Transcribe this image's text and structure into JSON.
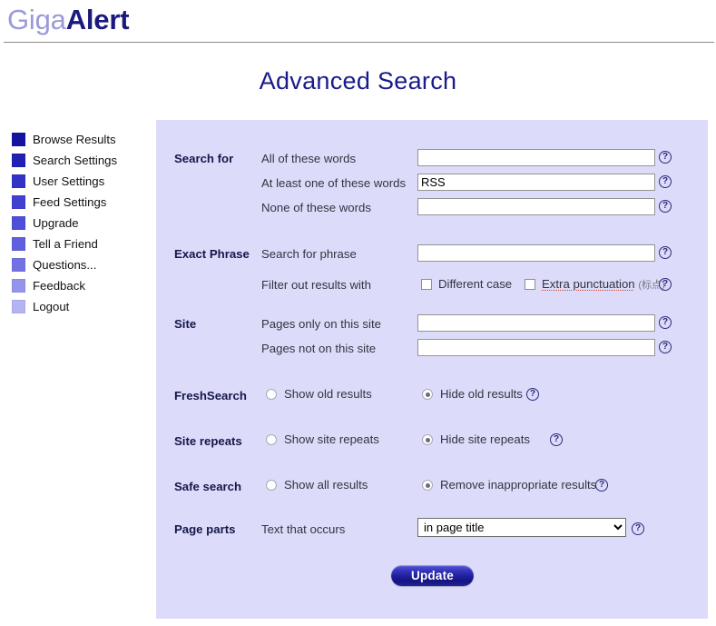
{
  "header": {
    "logo_part1": "Giga",
    "logo_part2": "Alert"
  },
  "page_title": "Advanced Search",
  "sidebar": {
    "items": [
      {
        "label": "Browse Results",
        "color": "#1414a0"
      },
      {
        "label": "Search Settings",
        "color": "#2020b4"
      },
      {
        "label": "User Settings",
        "color": "#3232c8"
      },
      {
        "label": "Feed Settings",
        "color": "#4040d2"
      },
      {
        "label": "Upgrade",
        "color": "#4e4ed8"
      },
      {
        "label": "Tell a Friend",
        "color": "#6060de"
      },
      {
        "label": "Questions...",
        "color": "#7272e4"
      },
      {
        "label": "Feedback",
        "color": "#9494ec"
      },
      {
        "label": "Logout",
        "color": "#b4b4f4"
      }
    ]
  },
  "form": {
    "search_for": {
      "section": "Search for",
      "all_words_label": "All of these words",
      "all_words_value": "",
      "any_words_label": "At least one of these words",
      "any_words_value": "RSS",
      "none_words_label": "None of these words",
      "none_words_value": ""
    },
    "exact_phrase": {
      "section": "Exact Phrase",
      "phrase_label": "Search for phrase",
      "phrase_value": "",
      "filter_label": "Filter out results with",
      "different_case_label": "Different case",
      "different_case_checked": false,
      "extra_punctuation_label": "Extra punctuation",
      "extra_punctuation_cjk": "(标点)",
      "extra_punctuation_checked": false
    },
    "site": {
      "section": "Site",
      "only_label": "Pages only on this site",
      "only_value": "",
      "not_label": "Pages not on this site",
      "not_value": ""
    },
    "freshsearch": {
      "section": "FreshSearch",
      "option_show": "Show old results",
      "option_hide": "Hide old results",
      "selected": "hide"
    },
    "site_repeats": {
      "section": "Site repeats",
      "option_show": "Show site repeats",
      "option_hide": "Hide site repeats",
      "selected": "hide"
    },
    "safe_search": {
      "section": "Safe search",
      "option_show": "Show all results",
      "option_remove": "Remove inappropriate results",
      "selected": "remove"
    },
    "page_parts": {
      "section": "Page parts",
      "text_label": "Text that occurs",
      "selected_option": "in page title",
      "options": [
        "in page title"
      ]
    },
    "help_icon": "?",
    "submit_label": "Update"
  },
  "colors": {
    "panel_bg": "#dcdcfa",
    "accent_navy": "#1a1a8c",
    "logo_light": "#9a9ada"
  }
}
